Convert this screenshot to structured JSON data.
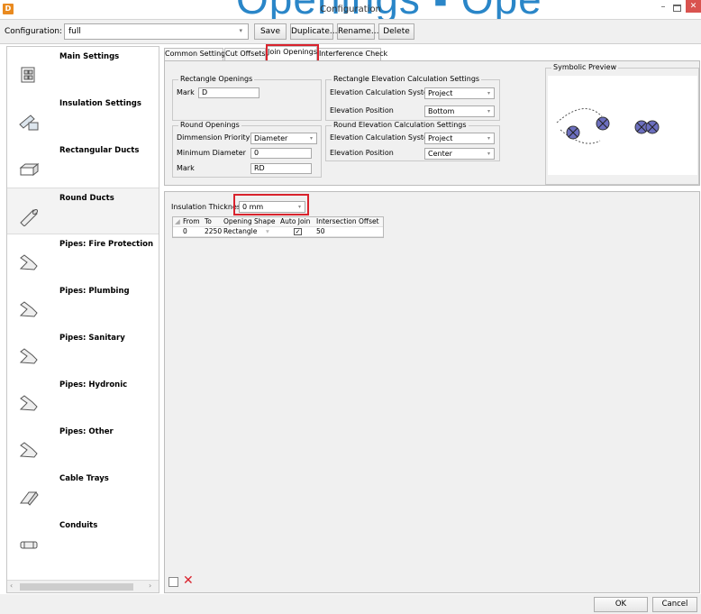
{
  "window": {
    "title": "Configuration",
    "overlay_heading": "Openings ▪ Ope",
    "app_icon": "D",
    "minimize": "–",
    "close": "✕"
  },
  "config_bar": {
    "label": "Configuration:",
    "selected": "full",
    "buttons": {
      "save": "Save",
      "duplicate": "Duplicate...",
      "rename": "Rename...",
      "delete": "Delete"
    }
  },
  "sidebar": {
    "items": [
      {
        "label": "Main Settings",
        "icon": "main-settings-icon"
      },
      {
        "label": "Insulation Settings",
        "icon": "insulation-icon"
      },
      {
        "label": "Rectangular Ducts",
        "icon": "rect-duct-icon"
      },
      {
        "label": "Round Ducts",
        "icon": "round-duct-icon"
      },
      {
        "label": "Pipes: Fire Protection",
        "icon": "pipe-icon"
      },
      {
        "label": "Pipes: Plumbing",
        "icon": "pipe-icon"
      },
      {
        "label": "Pipes: Sanitary",
        "icon": "pipe-icon"
      },
      {
        "label": "Pipes: Hydronic",
        "icon": "pipe-icon"
      },
      {
        "label": "Pipes: Other",
        "icon": "pipe-icon"
      },
      {
        "label": "Cable Trays",
        "icon": "cable-tray-icon"
      },
      {
        "label": "Conduits",
        "icon": "conduit-icon"
      }
    ],
    "active_index": 3
  },
  "tabs": [
    "Common Settings",
    "Cut Offsets",
    "Join Openings",
    "Interference Check"
  ],
  "active_tab": "Join Openings",
  "rect_openings": {
    "title": "Rectangle Openings",
    "mark_label": "Mark",
    "mark_value": "D"
  },
  "rect_elevation": {
    "title": "Rectangle Elevation Calculation Settings",
    "system_label": "Elevation Calculation System",
    "system_value": "Project",
    "position_label": "Elevation Position",
    "position_value": "Bottom"
  },
  "round_openings": {
    "title": "Round Openings",
    "priority_label": "Dimmension Priority",
    "priority_value": "Diameter",
    "min_diameter_label": "Minimum Diameter",
    "min_diameter_value": "0",
    "mark_label": "Mark",
    "mark_value": "RD"
  },
  "round_elevation": {
    "title": "Round Elevation Calculation Settings",
    "system_label": "Elevation Calculation System",
    "system_value": "Project",
    "position_label": "Elevation Position",
    "position_value": "Center"
  },
  "preview": {
    "title": "Symbolic Preview"
  },
  "insulation": {
    "label": "Insulation Thickness",
    "value": "0 mm"
  },
  "grid": {
    "headers": [
      "From",
      "To",
      "Opening Shape",
      "Auto Join",
      "Intersection Offset"
    ],
    "rows": [
      {
        "from": "0",
        "to": "2250",
        "shape": "Rectangle",
        "auto_join": true,
        "auto_join_mark": "✓",
        "offset": "50"
      }
    ]
  },
  "footer": {
    "ok": "OK",
    "cancel": "Cancel"
  },
  "colors": {
    "highlight": "#d9232d",
    "accent": "#2a86c8",
    "preview_fill": "#6c6fbf"
  }
}
